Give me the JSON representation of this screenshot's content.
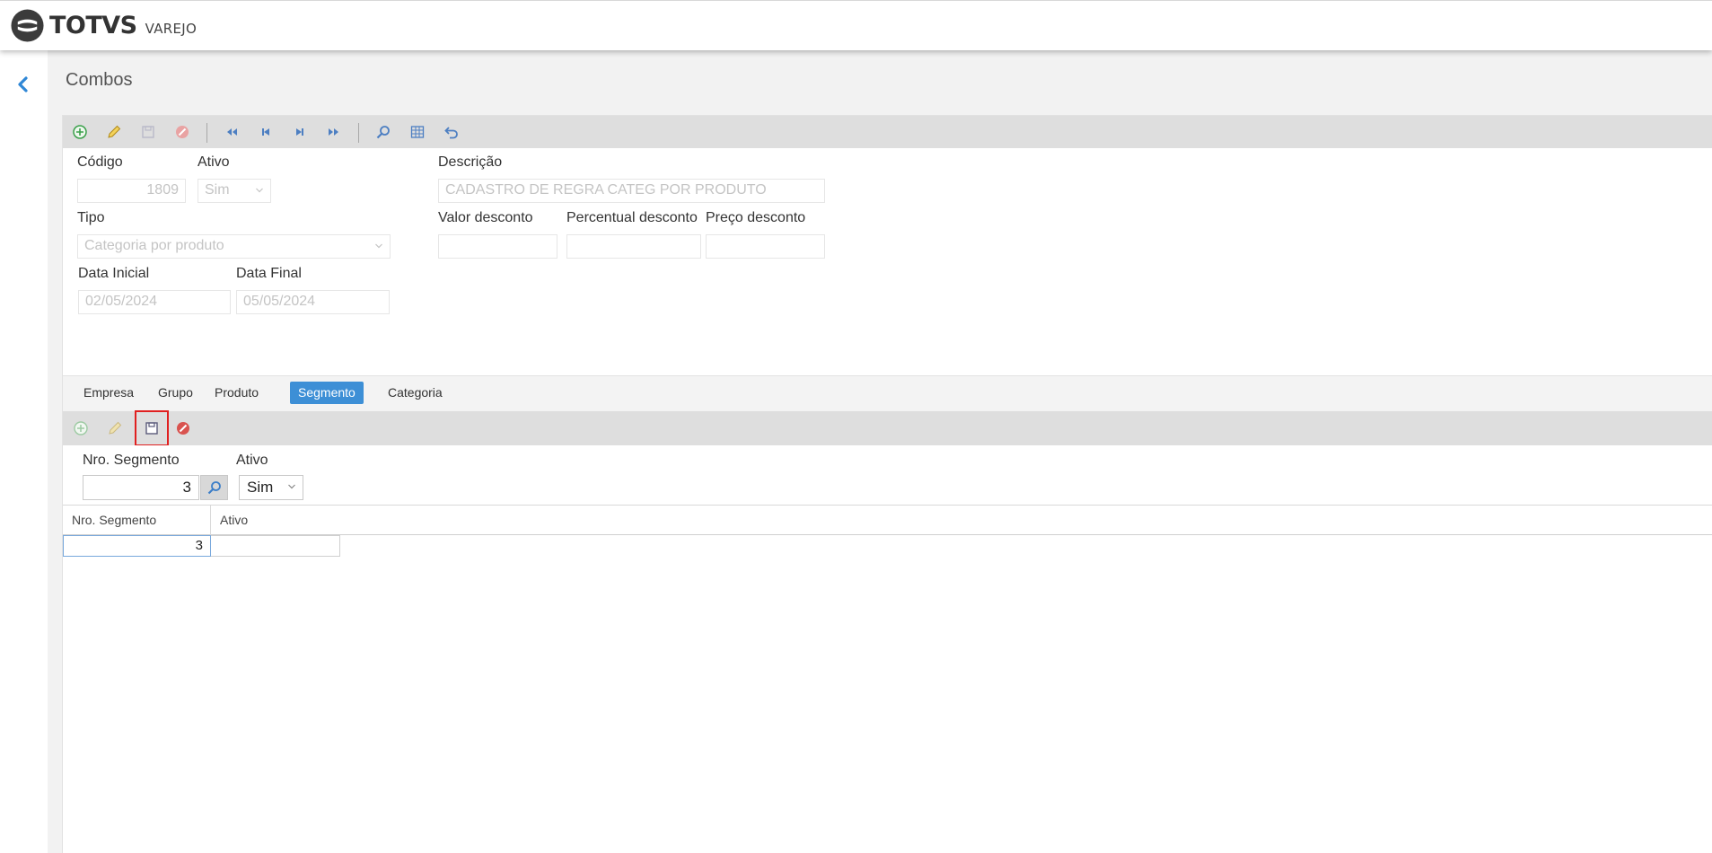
{
  "app": {
    "brand": "TOTVS",
    "brand_sub": "VAREJO"
  },
  "page": {
    "title": "Combos"
  },
  "toolbar": {
    "icons": [
      "add-icon",
      "edit-icon",
      "save-icon",
      "cancel-icon",
      "first-record-icon",
      "previous-record-icon",
      "next-record-icon",
      "last-record-icon",
      "search-icon",
      "grid-view-icon",
      "undo-icon"
    ]
  },
  "form": {
    "codigo_label": "Código",
    "codigo_value": "1809",
    "ativo_label": "Ativo",
    "ativo_value": "Sim",
    "descricao_label": "Descrição",
    "descricao_value": "CADASTRO DE REGRA CATEG POR PRODUTO",
    "tipo_label": "Tipo",
    "tipo_value": "Categoria por produto",
    "valor_desconto_label": "Valor desconto",
    "valor_desconto_value": "",
    "percentual_desconto_label": "Percentual desconto",
    "percentual_desconto_value": "",
    "preco_desconto_label": "Preço desconto",
    "preco_desconto_value": "",
    "data_inicial_label": "Data Inicial",
    "data_inicial_value": "02/05/2024",
    "data_final_label": "Data Final",
    "data_final_value": "05/05/2024"
  },
  "tabs": [
    {
      "label": "Empresa",
      "active": false
    },
    {
      "label": "Grupo",
      "active": false
    },
    {
      "label": "Produto",
      "active": false
    },
    {
      "label": "Segmento",
      "active": true
    },
    {
      "label": "Categoria",
      "active": false
    }
  ],
  "segment_form": {
    "nro_label": "Nro. Segmento",
    "nro_value": "3",
    "ativo_label": "Ativo",
    "ativo_value": "Sim"
  },
  "grid": {
    "columns": [
      "Nro. Segmento",
      "Ativo"
    ],
    "rows": [
      {
        "nro": "3",
        "ativo": ""
      }
    ]
  },
  "colors": {
    "accent": "#3d8fd6",
    "highlight": "#e02020",
    "add_green": "#3aa04a",
    "cancel_red": "#d9534f",
    "nav_blue": "#2f87d6"
  }
}
